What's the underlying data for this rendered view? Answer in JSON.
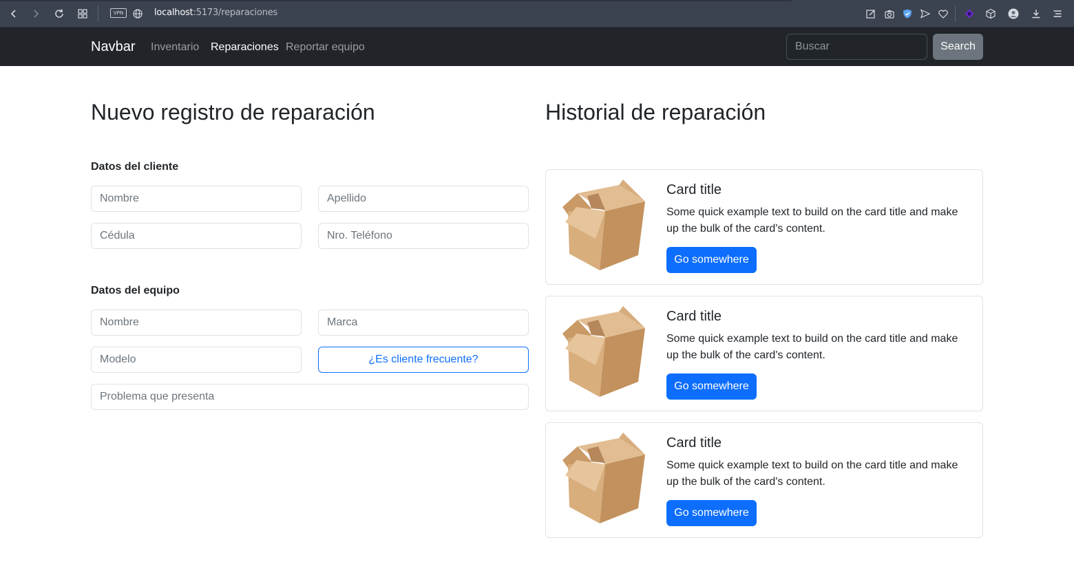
{
  "browser": {
    "vpn_label": "VPN",
    "url_host": "localhost",
    "url_path": ":5173/reparaciones"
  },
  "navbar": {
    "brand": "Navbar",
    "links": [
      {
        "label": "Inventario",
        "active": false
      },
      {
        "label": "Reparaciones",
        "active": true
      },
      {
        "label": "Reportar equipo",
        "active": false
      }
    ],
    "search_placeholder": "Buscar",
    "search_button": "Search"
  },
  "form": {
    "title": "Nuevo registro de reparación",
    "client_section": "Datos del cliente",
    "client_fields": {
      "nombre": "Nombre",
      "apellido": "Apellido",
      "cedula": "Cédula",
      "telefono": "Nro. Teléfono"
    },
    "equipment_section": "Datos del equipo",
    "equipment_fields": {
      "nombre": "Nombre",
      "marca": "Marca",
      "modelo": "Modelo",
      "problema": "Problema que presenta"
    },
    "frequent_client_button": "¿Es cliente frecuente?"
  },
  "history": {
    "title": "Historial de reparación",
    "cards": [
      {
        "title": "Card title",
        "text": "Some quick example text to build on the card title and make up the bulk of the card's content.",
        "button": "Go somewhere"
      },
      {
        "title": "Card title",
        "text": "Some quick example text to build on the card title and make up the bulk of the card's content.",
        "button": "Go somewhere"
      },
      {
        "title": "Card title",
        "text": "Some quick example text to build on the card title and make up the bulk of the card's content.",
        "button": "Go somewhere"
      }
    ]
  },
  "colors": {
    "navbar_bg": "#212529",
    "primary": "#0d6efd",
    "secondary": "#6c757d",
    "browser_bg": "#3c4350"
  }
}
